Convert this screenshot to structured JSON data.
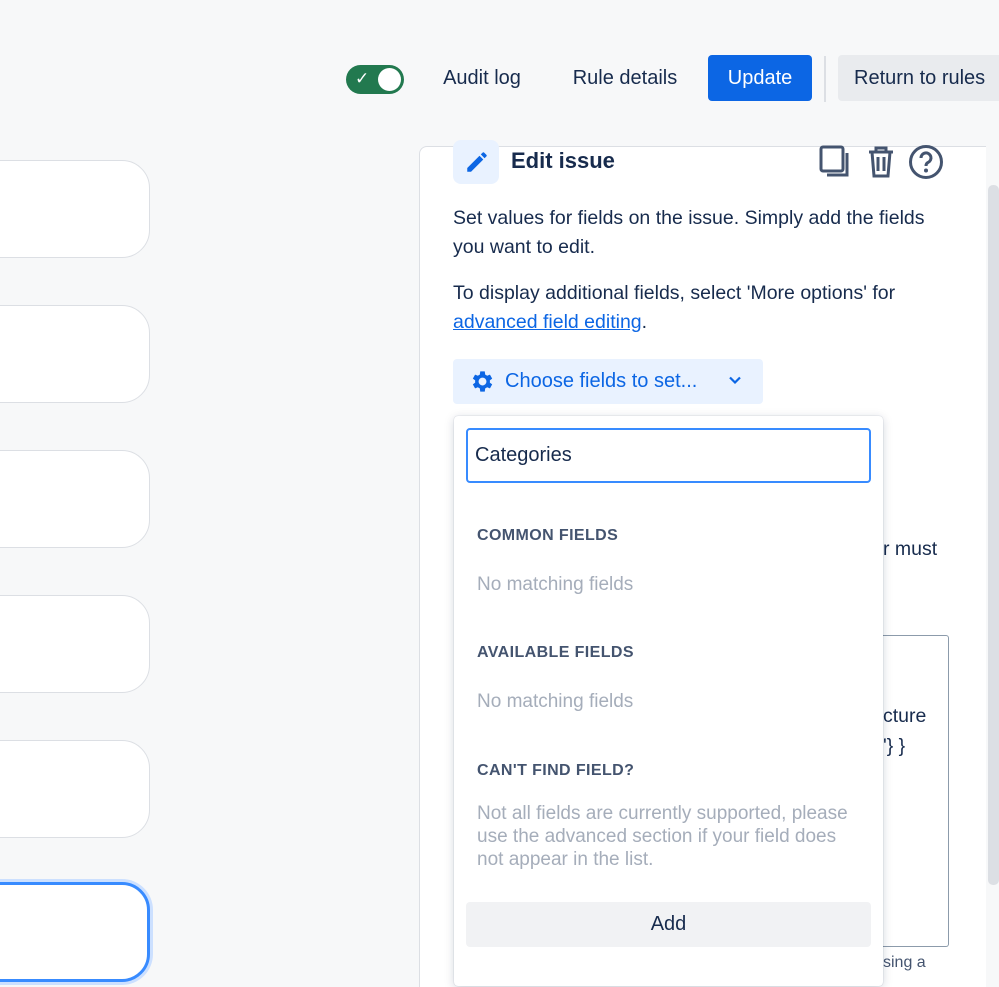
{
  "header": {
    "toggle_state": "on",
    "audit_log": "Audit log",
    "rule_details": "Rule details",
    "update": "Update",
    "return_to_rules": "Return to rules"
  },
  "panel": {
    "title": "Edit issue",
    "description_1": "Set values for fields on the issue. Simply add the fields you want to edit.",
    "description_2_prefix": "To display additional fields, select 'More options' for ",
    "description_2_link": "advanced field editing",
    "description_2_suffix": ".",
    "choose_fields": "Choose fields to set...",
    "obscured_1": "r must",
    "obscured_2": "cture",
    "obscured_3": "'} }",
    "obscured_4": "sing a"
  },
  "dropdown": {
    "search_value": "Categories",
    "common_fields_heading": "COMMON FIELDS",
    "common_fields_empty": "No matching fields",
    "available_fields_heading": "AVAILABLE FIELDS",
    "available_fields_empty": "No matching fields",
    "cant_find_heading": "CAN'T FIND FIELD?",
    "cant_find_note": "Not all fields are currently supported, please use the advanced section if your field does not appear in the list.",
    "add_button": "Add"
  },
  "colors": {
    "primary": "#0c66e4",
    "toggle_on": "#22794f",
    "selected_border": "#388bff"
  },
  "icons": [
    "check-icon",
    "pencil-icon",
    "copy-icon",
    "trash-icon",
    "help-icon",
    "gear-icon",
    "chevron-down-icon"
  ]
}
